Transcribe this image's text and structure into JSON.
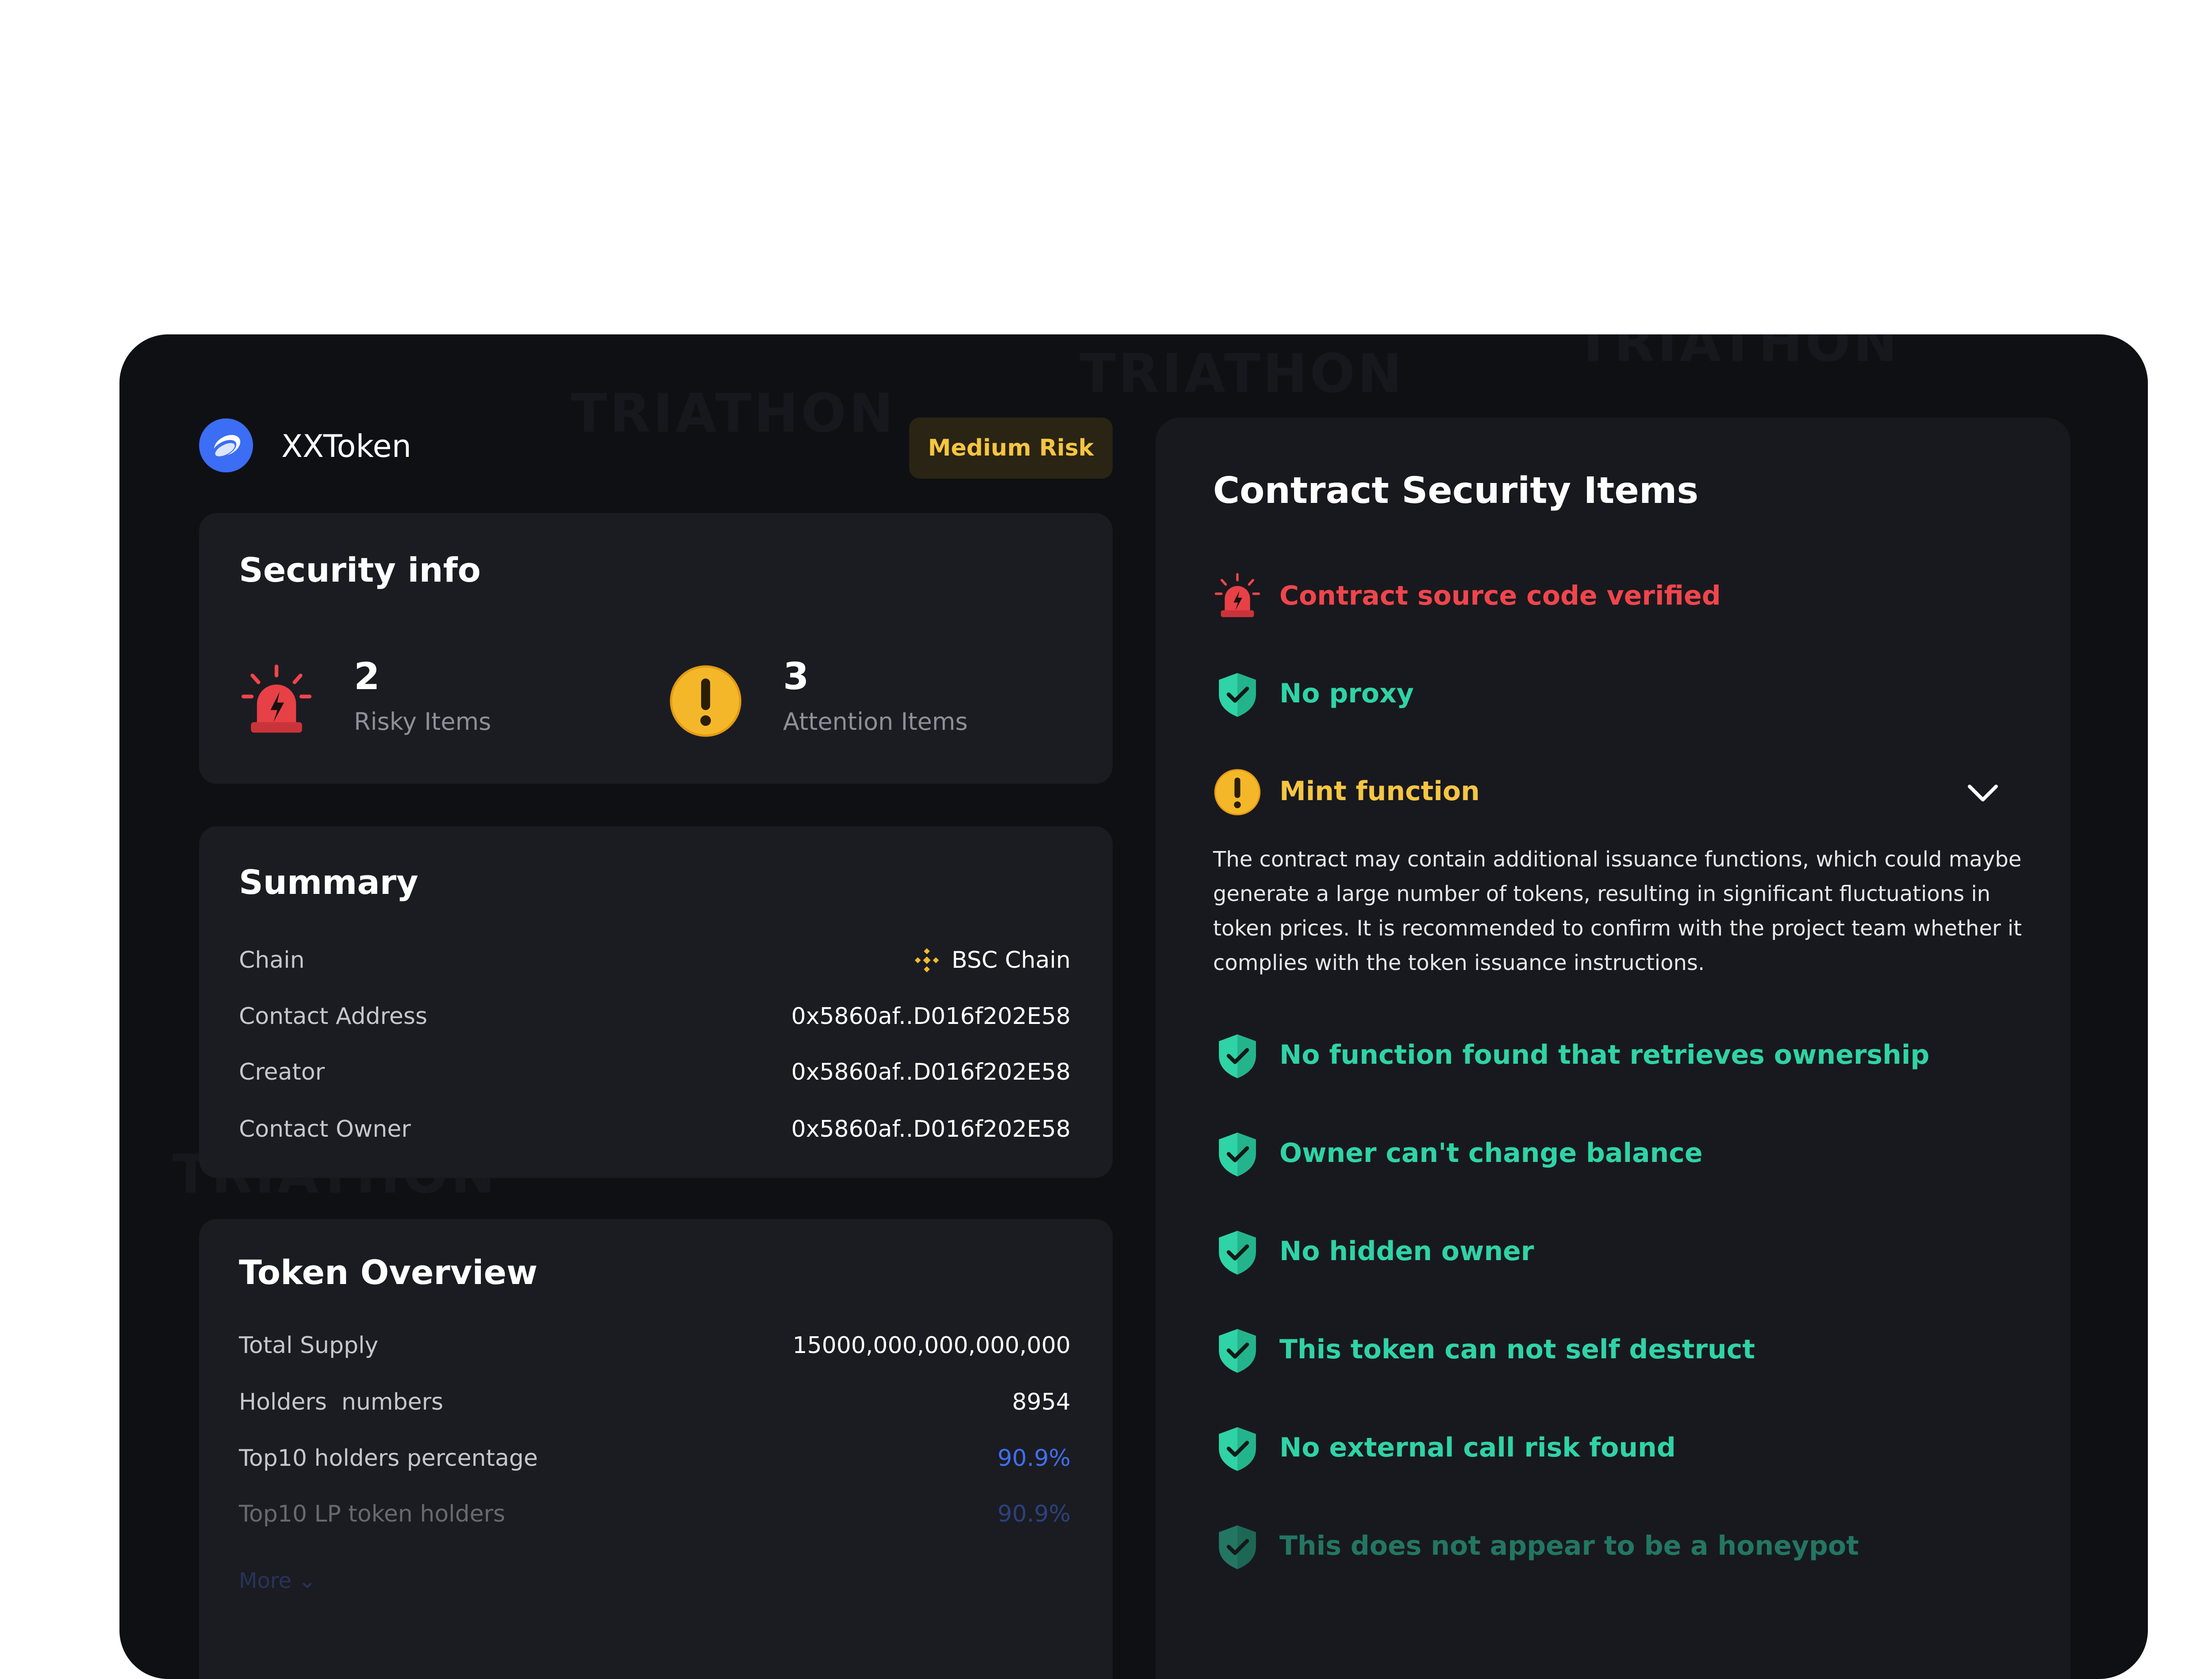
{
  "header": {
    "token_name": "XXToken",
    "risk_badge": "Medium Risk",
    "logo_icon": "token-logo-icon"
  },
  "security_info": {
    "title": "Security info",
    "risky": {
      "count": "2",
      "label": "Risky Items",
      "icon": "alarm-siren-icon"
    },
    "attention": {
      "count": "3",
      "label": "Attention Items",
      "icon": "warning-exclamation-icon"
    }
  },
  "summary": {
    "title": "Summary",
    "rows": [
      {
        "label": "Chain",
        "value": "BSC Chain",
        "icon": "bnb-chain-icon"
      },
      {
        "label": "Contact Address",
        "value": "0x5860af..D016f202E58"
      },
      {
        "label": "Creator",
        "value": "0x5860af..D016f202E58"
      },
      {
        "label": "Contact Owner",
        "value": "0x5860af..D016f202E58"
      }
    ]
  },
  "token_overview": {
    "title": "Token Overview",
    "rows": [
      {
        "label": "Total Supply",
        "value": "15000,000,000,000,000"
      },
      {
        "label": "Holders  numbers",
        "value": "8954"
      },
      {
        "label": "Top10 holders percentage",
        "value": "90.9%"
      },
      {
        "label": "Top10 LP token holders",
        "value": "90.9%"
      }
    ],
    "more_label": "More"
  },
  "contract_security": {
    "title": "Contract Security Items",
    "items": [
      {
        "label": "Contract source code verified",
        "status": "risk",
        "icon": "alarm-siren-icon"
      },
      {
        "label": "No proxy",
        "status": "safe",
        "icon": "shield-check-icon"
      },
      {
        "label": "Mint function",
        "status": "attention",
        "icon": "warning-exclamation-icon",
        "expanded": true
      },
      {
        "label": "No function found that retrieves ownership",
        "status": "safe",
        "icon": "shield-check-icon"
      },
      {
        "label": "Owner can't change balance",
        "status": "safe",
        "icon": "shield-check-icon"
      },
      {
        "label": "No hidden owner",
        "status": "safe",
        "icon": "shield-check-icon"
      },
      {
        "label": "This token can not self destruct",
        "status": "safe",
        "icon": "shield-check-icon"
      },
      {
        "label": "No external call risk found",
        "status": "safe",
        "icon": "shield-check-icon"
      },
      {
        "label": "This does not appear to be a honeypot",
        "status": "safe",
        "icon": "shield-check-icon"
      }
    ],
    "mint_description": "The contract may contain additional issuance functions, which could maybe generate a large number of tokens, resulting in significant fluctuations in token prices. It is recommended to confirm with the project team whether it complies with the token issuance instructions."
  },
  "colors": {
    "background": "#0f1014",
    "card": "#1b1c21",
    "risk_red": "#f0454c",
    "safe_green": "#2fd3a6",
    "attention_yellow": "#f5c542",
    "link_blue": "#3f6ff0"
  },
  "watermark": "TRIATHON"
}
